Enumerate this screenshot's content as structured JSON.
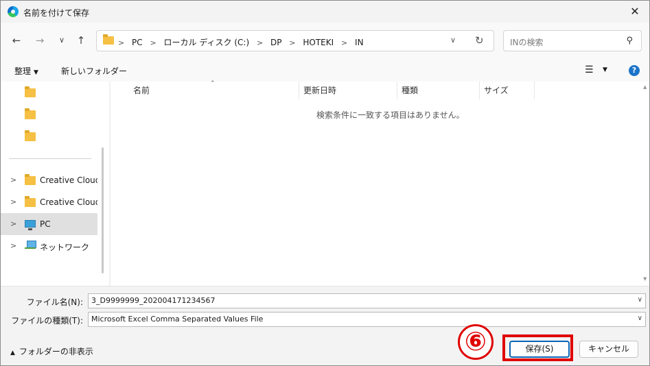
{
  "window": {
    "title": "名前を付けて保存",
    "app_icon": "edge-icon"
  },
  "nav": {
    "breadcrumb": [
      "PC",
      "ローカル ディスク (C:)",
      "DP",
      "HOTEKI",
      "IN"
    ],
    "search_placeholder": "INの検索"
  },
  "toolbar": {
    "organize_label": "整理",
    "new_folder_label": "新しいフォルダー"
  },
  "tree": {
    "items": [
      {
        "label": "",
        "icon": "folder-icon",
        "expandable": false
      },
      {
        "label": "",
        "icon": "folder-icon",
        "expandable": false
      },
      {
        "label": "",
        "icon": "folder-icon",
        "expandable": false
      },
      {
        "label": "Creative Cloud F",
        "icon": "folder-icon",
        "expandable": true
      },
      {
        "label": "Creative Cloud F",
        "icon": "folder-icon",
        "expandable": true
      },
      {
        "label": "PC",
        "icon": "pc-icon",
        "expandable": true,
        "selected": true
      },
      {
        "label": "ネットワーク",
        "icon": "network-icon",
        "expandable": true
      }
    ]
  },
  "filelist": {
    "columns": [
      "名前",
      "更新日時",
      "種類",
      "サイズ"
    ],
    "empty_message": "検索条件に一致する項目はありません。"
  },
  "fields": {
    "filename_label": "ファイル名(N):",
    "filename_value": "3_D9999999_202004171234567",
    "filetype_label": "ファイルの種類(T):",
    "filetype_value": "Microsoft Excel Comma Separated Values File"
  },
  "footer": {
    "hide_folders_label": "フォルダーの非表示",
    "save_label": "保存(S)",
    "cancel_label": "キャンセル"
  },
  "annotation": {
    "step_number": "⑥",
    "color": "#e00000"
  },
  "colors": {
    "accent": "#0a64b8",
    "help": "#1b74c9",
    "folder": "#f5c043"
  }
}
